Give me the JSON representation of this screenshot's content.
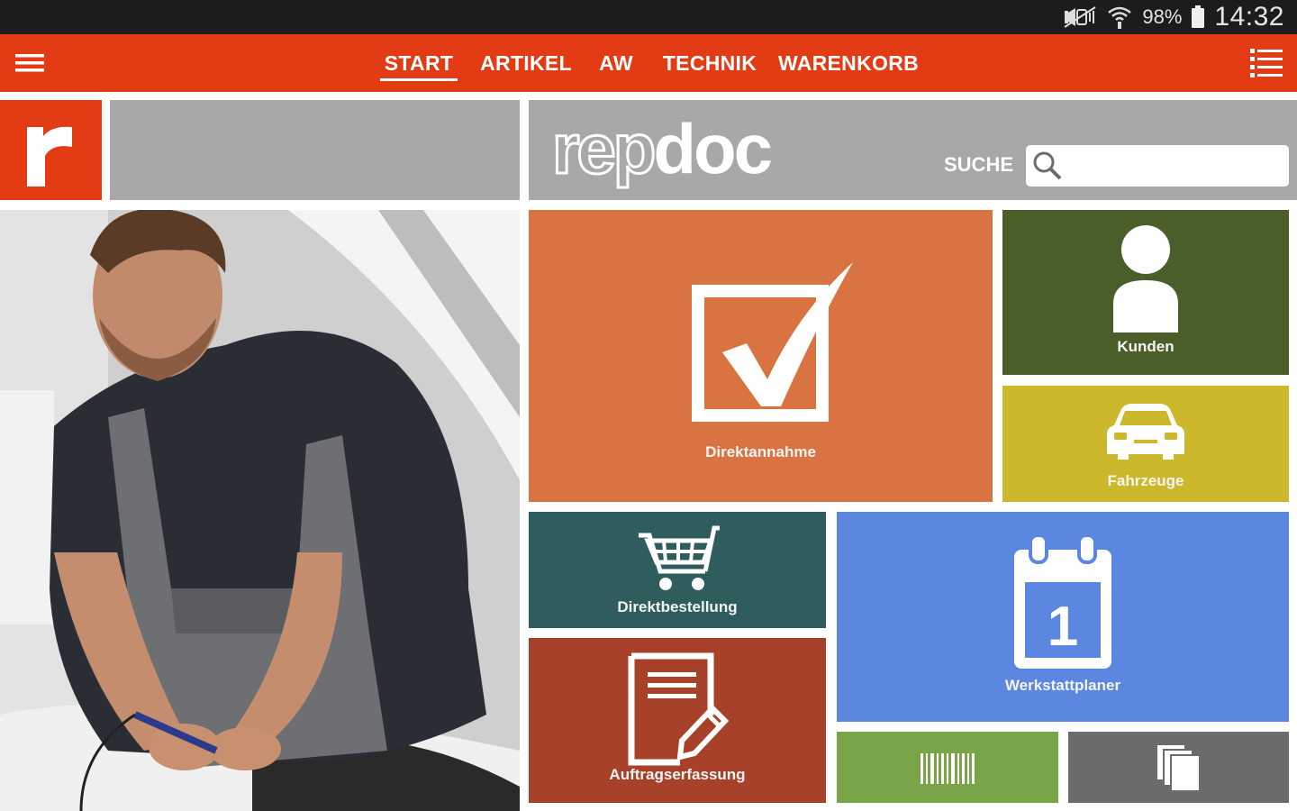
{
  "status_bar": {
    "battery": "98%",
    "time": "14:32",
    "icons": [
      "mute-vibrate-icon",
      "wifi-icon",
      "battery-icon"
    ]
  },
  "app_bar": {
    "menu_icon": "hamburger-icon",
    "list_icon": "list-view-icon",
    "tabs": [
      {
        "label": "START",
        "active": true
      },
      {
        "label": "ARTIKEL",
        "active": false
      },
      {
        "label": "AW",
        "active": false
      },
      {
        "label": "TECHNIK",
        "active": false
      },
      {
        "label": "WARENKORB",
        "active": false
      }
    ],
    "color": "#e33b13"
  },
  "brand": {
    "logo_letter": "r",
    "wordmark_light": "rep",
    "wordmark_bold": "doc"
  },
  "search": {
    "label": "SUCHE",
    "placeholder": "",
    "value": ""
  },
  "hero_image": {
    "description_icon": "mechanic-photo"
  },
  "tiles": {
    "direktannahme": {
      "label": "Direktannahme",
      "icon": "checkbox-check-icon",
      "color": "#d97442"
    },
    "kunden": {
      "label": "Kunden",
      "icon": "person-icon",
      "color": "#4a5e2a"
    },
    "fahrzeuge": {
      "label": "Fahrzeuge",
      "icon": "car-icon",
      "color": "#cdb72a"
    },
    "direktbestellung": {
      "label": "Direktbestellung",
      "icon": "shopping-cart-icon",
      "color": "#2f5c5c"
    },
    "werkstattplaner": {
      "label": "Werkstattplaner",
      "icon": "calendar-icon",
      "calendar_day": "1",
      "color": "#5b87e0"
    },
    "auftragserfassung": {
      "label": "Auftragserfassung",
      "icon": "document-edit-icon",
      "color": "#a8412a"
    },
    "barcode": {
      "label": "",
      "icon": "barcode-icon",
      "color": "#79a447"
    },
    "documents": {
      "label": "",
      "icon": "documents-icon",
      "color": "#6b6b6b"
    }
  }
}
